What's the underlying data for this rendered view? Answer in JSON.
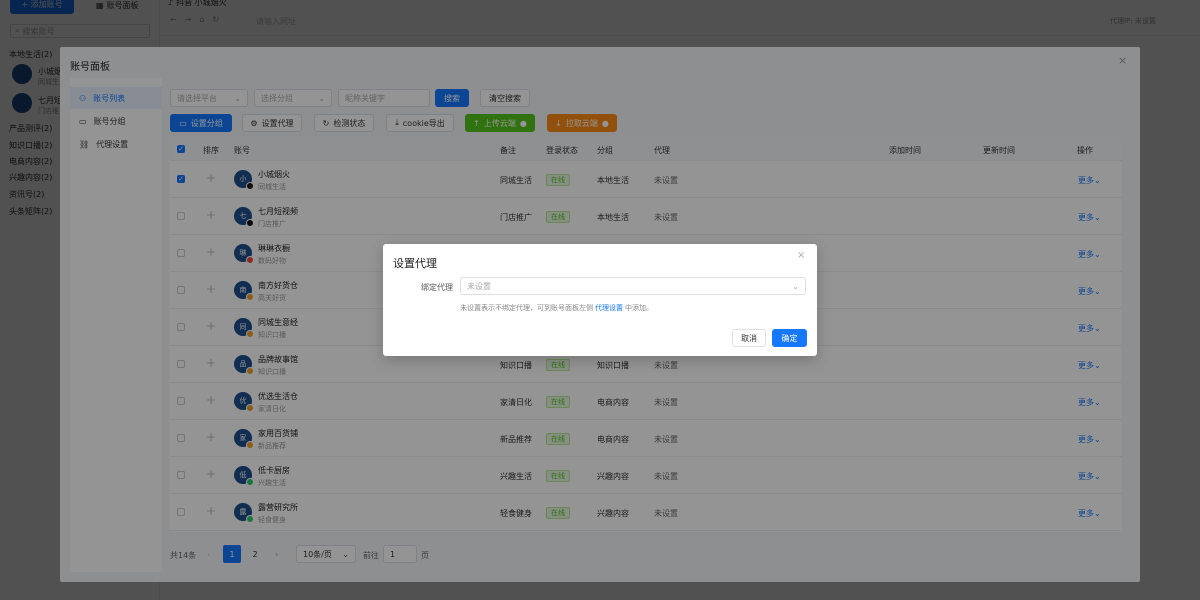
{
  "app": {
    "add_account": "+ 添加账号",
    "account_panel_tab": "账号面板",
    "tab_title": "抖音 小城烟火",
    "url_placeholder": "请输入网址",
    "topright": "代理IP: 未设置",
    "search_placeholder": "搜索账号",
    "groups": [
      {
        "label": "本地生活(2)"
      },
      {
        "label": "产品测评(2)"
      },
      {
        "label": "知识口播(2)"
      },
      {
        "label": "电商内容(2)"
      },
      {
        "label": "兴趣内容(2)"
      },
      {
        "label": "资讯号(2)"
      },
      {
        "label": "头条矩阵(2)"
      }
    ],
    "side_accounts": [
      {
        "name": "小城烟",
        "sub": "同城生"
      },
      {
        "name": "七月短",
        "sub": "门店推"
      }
    ]
  },
  "panel": {
    "title": "账号面板",
    "nav": [
      {
        "label": "账号列表",
        "icon": "user-icon"
      },
      {
        "label": "账号分组",
        "icon": "folder-icon"
      },
      {
        "label": "代理设置",
        "icon": "proxy-icon"
      }
    ],
    "filters": {
      "platform_placeholder": "请选择平台",
      "group_placeholder": "选择分组",
      "keyword_placeholder": "昵称关键字",
      "search_label": "搜索",
      "clear_label": "清空搜索"
    },
    "toolbar": {
      "set_group": "设置分组",
      "set_proxy": "设置代理",
      "check_status": "检测状态",
      "cookie_export": "cookie导出",
      "upload_cloud": "上传云端",
      "pull_cloud": "拉取云端"
    },
    "table": {
      "headers": {
        "order": "排序",
        "account": "账号",
        "note": "备注",
        "login": "登录状态",
        "group": "分组",
        "proxy": "代理",
        "added": "添加时间",
        "updated": "更新时间",
        "action": "操作"
      },
      "rows": [
        {
          "avatar": "小",
          "name": "小城烟火",
          "sub": "同城生活",
          "note": "同城生活",
          "status": "在线",
          "group": "本地生活",
          "proxy": "未设置",
          "more": "更多",
          "checked": true,
          "badge": "#111"
        },
        {
          "avatar": "七",
          "name": "七月短视频",
          "sub": "门店推广",
          "note": "门店推广",
          "status": "在线",
          "group": "本地生活",
          "proxy": "未设置",
          "more": "更多",
          "checked": false,
          "badge": "#111"
        },
        {
          "avatar": "琳",
          "name": "琳琳衣橱",
          "sub": "数码好物",
          "note": "",
          "status": "",
          "group": "",
          "proxy": "",
          "more": "更多",
          "checked": false,
          "badge": "#e74c3c"
        },
        {
          "avatar": "南",
          "name": "南方好货仓",
          "sub": "高关好货",
          "note": "",
          "status": "",
          "group": "",
          "proxy": "",
          "more": "更多",
          "checked": false,
          "badge": "#f0a030"
        },
        {
          "avatar": "同",
          "name": "同城生意经",
          "sub": "知识口播",
          "note": "",
          "status": "",
          "group": "",
          "proxy": "",
          "more": "更多",
          "checked": false,
          "badge": "#f0a030"
        },
        {
          "avatar": "品",
          "name": "品牌故事馆",
          "sub": "知识口播",
          "note": "知识口播",
          "status": "在线",
          "group": "知识口播",
          "proxy": "未设置",
          "more": "更多",
          "checked": false,
          "badge": "#f0a030"
        },
        {
          "avatar": "优",
          "name": "优选生活仓",
          "sub": "家清日化",
          "note": "家清日化",
          "status": "在线",
          "group": "电商内容",
          "proxy": "未设置",
          "more": "更多",
          "checked": false,
          "badge": "#f0a030"
        },
        {
          "avatar": "家",
          "name": "家用百货铺",
          "sub": "新品推荐",
          "note": "新品推荐",
          "status": "在线",
          "group": "电商内容",
          "proxy": "未设置",
          "more": "更多",
          "checked": false,
          "badge": "#f0a030"
        },
        {
          "avatar": "低",
          "name": "低卡厨房",
          "sub": "兴趣生活",
          "note": "兴趣生活",
          "status": "在线",
          "group": "兴趣内容",
          "proxy": "未设置",
          "more": "更多",
          "checked": false,
          "badge": "#2ecc71"
        },
        {
          "avatar": "露",
          "name": "露营研究所",
          "sub": "轻食健身",
          "note": "轻食健身",
          "status": "在线",
          "group": "兴趣内容",
          "proxy": "未设置",
          "more": "更多",
          "checked": false,
          "badge": "#2ecc71"
        }
      ]
    },
    "pagination": {
      "total": "共14条",
      "pages": [
        "1",
        "2"
      ],
      "page_size": "10条/页",
      "goto_label": "前往",
      "goto_value": "1",
      "page_suffix": "页"
    }
  },
  "dialog": {
    "title": "设置代理",
    "label": "绑定代理",
    "placeholder": "未设置",
    "hint_prefix": "未设置表示不绑定代理，可到账号面板左侧",
    "hint_link": "代理设置",
    "hint_suffix": "中添加。",
    "cancel": "取消",
    "confirm": "确定"
  }
}
